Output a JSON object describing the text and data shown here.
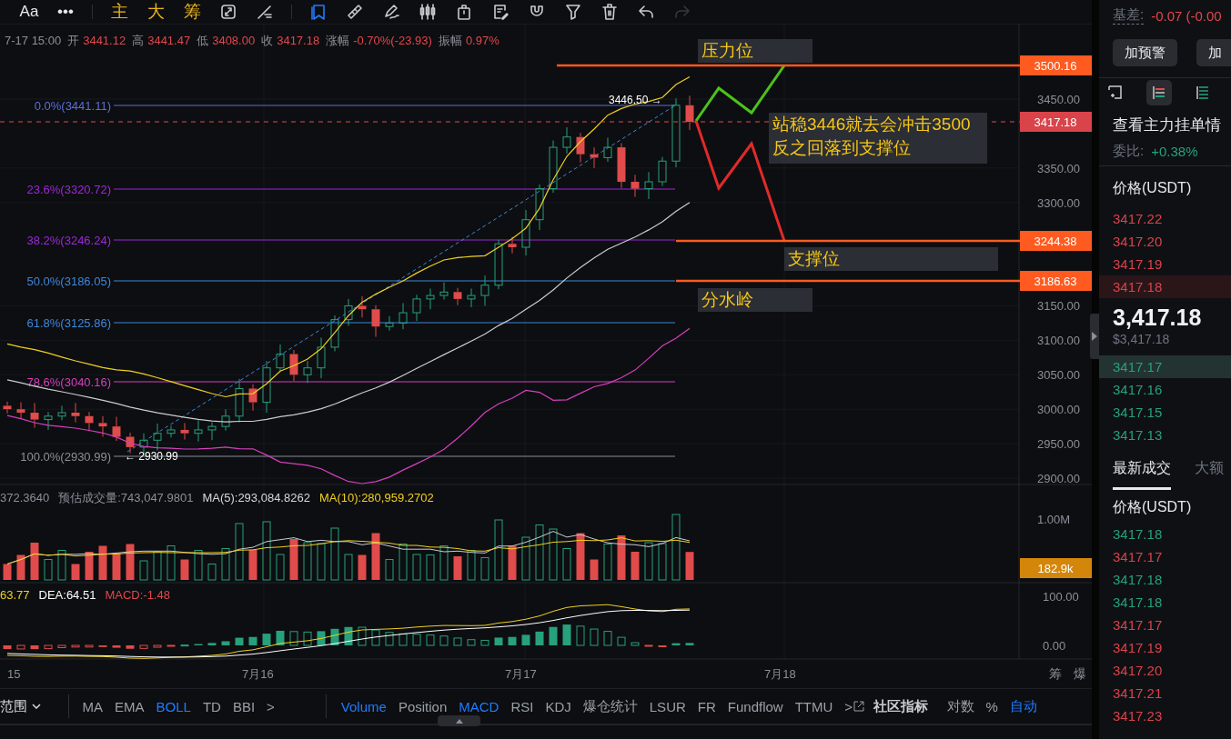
{
  "toolbar": {
    "items": [
      {
        "label": "Aa"
      },
      {
        "label": "•••"
      }
    ],
    "shortcuts": [
      {
        "label": "主"
      },
      {
        "label": "大"
      },
      {
        "label": "筹"
      }
    ],
    "tools": [
      {
        "kind": "cycle",
        "selected": false,
        "disabled": false
      },
      {
        "kind": "line",
        "selected": false,
        "disabled": false
      },
      {
        "kind": "bookmark",
        "selected": true,
        "disabled": false
      },
      {
        "kind": "ruler",
        "selected": false,
        "disabled": false
      },
      {
        "kind": "pencil",
        "selected": false,
        "disabled": false
      },
      {
        "kind": "candles",
        "selected": false,
        "disabled": false
      },
      {
        "kind": "container",
        "selected": false,
        "disabled": false
      },
      {
        "kind": "note",
        "selected": false,
        "disabled": false
      },
      {
        "kind": "magnet",
        "selected": false,
        "disabled": false
      },
      {
        "kind": "filter",
        "selected": false,
        "disabled": false
      },
      {
        "kind": "trash",
        "selected": false,
        "disabled": false
      },
      {
        "kind": "undo",
        "selected": false,
        "disabled": false
      },
      {
        "kind": "redo",
        "selected": false,
        "disabled": true
      }
    ]
  },
  "ohlc": {
    "time": "7-17 15:00",
    "fields": [
      {
        "label": "开",
        "value": "3441.12"
      },
      {
        "label": "高",
        "value": "3441.47"
      },
      {
        "label": "低",
        "value": "3408.00"
      },
      {
        "label": "收",
        "value": "3417.18"
      },
      {
        "label": "涨幅",
        "value": "-0.70%(-23.93)"
      },
      {
        "label": "振幅",
        "value": "0.97%"
      }
    ]
  },
  "fib_levels": [
    {
      "label": "0.0%(3441.11)",
      "color": "#5b6fd6"
    },
    {
      "label": "23.6%(3320.72)",
      "color": "#9c27d8"
    },
    {
      "label": "38.2%(3246.24)",
      "color": "#9c27d8"
    },
    {
      "label": "50.0%(3186.05)",
      "color": "#3f86d9"
    },
    {
      "label": "61.8%(3125.86)",
      "color": "#3f86d9"
    },
    {
      "label": "78.6%(3040.16)",
      "color": "#d63fbf"
    },
    {
      "label": "100.0%(2930.99)",
      "color": "#8a8f98"
    }
  ],
  "markers": [
    {
      "label": "3446.50 →"
    },
    {
      "label": "← 2930.99"
    }
  ],
  "annotations": [
    {
      "lines": [
        "压力位"
      ]
    },
    {
      "lines": [
        "站稳3446就去会冲击3500",
        "反之回落到支撑位"
      ]
    },
    {
      "lines": [
        "支撑位"
      ]
    },
    {
      "lines": [
        "分水岭"
      ]
    }
  ],
  "price_axis": {
    "ticks": [
      "3450.00",
      "3350.00",
      "3300.00",
      "3150.00",
      "3100.00",
      "3050.00",
      "3000.00",
      "2950.00",
      "2900.00"
    ],
    "tags": [
      {
        "kind": "level",
        "text": "3500.16"
      },
      {
        "kind": "current",
        "text": "3417.18"
      },
      {
        "kind": "level",
        "text": "3244.38"
      },
      {
        "kind": "level",
        "text": "3186.63"
      }
    ]
  },
  "volume": {
    "legend": [
      {
        "kind": "muted",
        "text": "372.3640"
      },
      {
        "kind": "muted",
        "text": "预估成交量:743,047.9801"
      },
      {
        "kind": "ma5",
        "text": "MA(5):293,084.8262"
      },
      {
        "kind": "ma10",
        "text": "MA(10):280,959.2702"
      }
    ],
    "axis_label": "1.00M",
    "tag": "182.9k"
  },
  "macd": {
    "legend": [
      {
        "kind": "dif",
        "text": "63.77"
      },
      {
        "kind": "dea",
        "text": "DEA:64.51"
      },
      {
        "kind": "macd",
        "text": "MACD:-1.48"
      }
    ],
    "ticks": [
      "100.00",
      "0.00"
    ]
  },
  "time_axis": {
    "labels": [
      "15",
      "7月16",
      "7月17",
      "7月18"
    ],
    "side_labels": [
      "筹",
      "爆"
    ]
  },
  "indicator_bar": {
    "range_label": "范围",
    "main": [
      {
        "label": "MA",
        "selected": false
      },
      {
        "label": "EMA",
        "selected": false
      },
      {
        "label": "BOLL",
        "selected": true
      },
      {
        "label": "TD",
        "selected": false
      },
      {
        "label": "BBI",
        "selected": false
      }
    ],
    "more": ">",
    "sub": [
      {
        "label": "Volume",
        "selected": true
      },
      {
        "label": "Position",
        "selected": false
      },
      {
        "label": "MACD",
        "selected": true
      },
      {
        "label": "RSI",
        "selected": false
      },
      {
        "label": "KDJ",
        "selected": false
      },
      {
        "label": "爆仓统计",
        "selected": false
      },
      {
        "label": "LSUR",
        "selected": false
      },
      {
        "label": "FR",
        "selected": false
      },
      {
        "label": "Fundflow",
        "selected": false
      },
      {
        "label": "TTMU",
        "selected": false
      }
    ],
    "sub_more": ">",
    "community": "社区指标",
    "options": [
      {
        "label": "对数",
        "selected": false
      },
      {
        "label": "%",
        "selected": false
      },
      {
        "label": "自动",
        "selected": true
      }
    ]
  },
  "side_panel": {
    "basis": {
      "label": "基差:",
      "value": "-0.07 (-0.00"
    },
    "buttons": [
      "加预警",
      "加"
    ],
    "view_tabs": [
      {
        "kind": "corner",
        "selected": false
      },
      {
        "kind": "book",
        "selected": true
      },
      {
        "kind": "bids",
        "selected": false
      }
    ],
    "title": "查看主力挂单情",
    "ratio": {
      "label": "委比:",
      "value": "+0.38%"
    },
    "price_header": "价格(USDT)",
    "asks": [
      {
        "price": "3417.22",
        "highlighted": false
      },
      {
        "price": "3417.20",
        "highlighted": false
      },
      {
        "price": "3417.19",
        "highlighted": false
      },
      {
        "price": "3417.18",
        "highlighted": true
      }
    ],
    "last_price": "3,417.18",
    "last_price_usd": "$3,417.18",
    "bids": [
      {
        "price": "3417.17",
        "highlighted": true
      },
      {
        "price": "3417.16",
        "highlighted": false
      },
      {
        "price": "3417.15",
        "highlighted": false
      },
      {
        "price": "3417.13",
        "highlighted": false
      }
    ],
    "trade_tabs": [
      {
        "label": "最新成交",
        "selected": true
      },
      {
        "label": "大额",
        "selected": false
      }
    ],
    "trades_header": "价格(USDT)",
    "trades": [
      {
        "price": "3417.18",
        "color": "#26a17b"
      },
      {
        "price": "3417.17",
        "color": "#d9434a"
      },
      {
        "price": "3417.18",
        "color": "#26a17b"
      },
      {
        "price": "3417.18",
        "color": "#26a17b"
      },
      {
        "price": "3417.17",
        "color": "#d9434a"
      },
      {
        "price": "3417.19",
        "color": "#d9434a"
      },
      {
        "price": "3417.20",
        "color": "#d9434a"
      },
      {
        "price": "3417.21",
        "color": "#d9434a"
      },
      {
        "price": "3417.23",
        "color": "#d9434a"
      }
    ]
  }
}
